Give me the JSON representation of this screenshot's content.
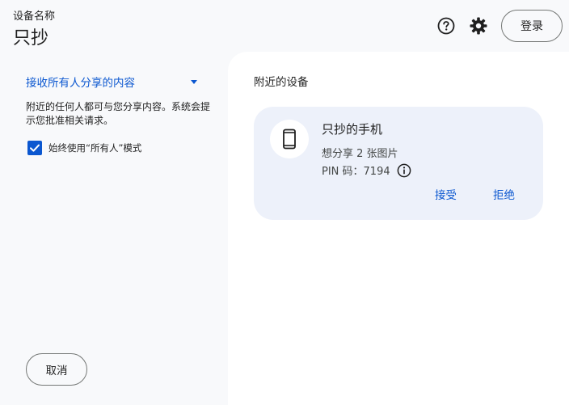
{
  "header": {
    "subtitle": "设备名称",
    "device_name": "只抄",
    "login_label": "登录"
  },
  "left": {
    "visibility_label": "接收所有人分享的内容",
    "description": "附近的任何人都可与您分享内容。系统会提示您批准相关请求。",
    "checkbox_label": "始终使用“所有人”模式",
    "checkbox_checked": true,
    "cancel_label": "取消"
  },
  "right": {
    "section_title": "附近的设备",
    "card": {
      "device_name": "只抄的手机",
      "share_text": "想分享 2 张图片",
      "pin_text": "PIN 码：7194",
      "accept_label": "接受",
      "reject_label": "拒绝"
    }
  },
  "icons": {
    "help": "help-circle-icon",
    "settings": "gear-icon",
    "dropdown": "caret-down-icon",
    "check": "check-icon",
    "phone": "smartphone-icon",
    "info": "info-icon"
  },
  "colors": {
    "accent": "#0b57d0",
    "background": "#f8f9fb",
    "panel": "#ffffff",
    "card": "#edf1fa"
  }
}
